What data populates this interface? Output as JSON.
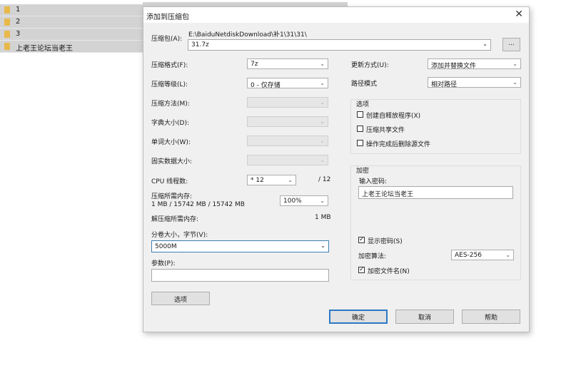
{
  "files": [
    "1",
    "2",
    "3",
    "上老王论坛当老王"
  ],
  "dialog": {
    "title": "添加到压缩包",
    "close_glyph": "✕",
    "archive_label": "压缩包(A):",
    "archive_path": "E:\\BaiduNetdiskDownload\\补1\\31\\31\\",
    "archive_name": "31.7z",
    "browse_label": "...",
    "format_label": "压缩格式(F):",
    "format_value": "7z",
    "level_label": "压缩等级(L):",
    "level_value": "0 - 仅存储",
    "method_label": "压缩方法(M):",
    "dict_label": "字典大小(D):",
    "word_label": "单词大小(W):",
    "solid_label": "固实数据大小:",
    "cpu_label": "CPU 线程数:",
    "cpu_value": "* 12",
    "cpu_max": "/ 12",
    "mem_comp_label": "压缩所需内存:",
    "mem_comp_detail": "1 MB / 15742 MB / 15742 MB",
    "mem_comp_value": "100%",
    "mem_decomp_label": "解压缩所需内存:",
    "mem_decomp_value": "1 MB",
    "split_label": "分卷大小，字节(V):",
    "split_value": "5000M",
    "params_label": "参数(P):",
    "params_value": "",
    "options_button": "选项",
    "update_label": "更新方式(U):",
    "update_value": "添加并替换文件",
    "path_label": "路径模式",
    "path_value": "相对路径",
    "options_group": "选项",
    "opt_sfx": "创建自释放程序(X)",
    "opt_shared": "压缩共享文件",
    "opt_delete": "操作完成后删除源文件",
    "encrypt_group": "加密",
    "password_label": "输入密码:",
    "password_value": "上老王论坛当老王",
    "show_password": "显示密码(S)",
    "enc_method_label": "加密算法:",
    "enc_method_value": "AES-256",
    "enc_filenames": "加密文件名(N)",
    "ok_button": "确定",
    "cancel_button": "取消",
    "help_button": "帮助",
    "check_glyph": "✓",
    "dropdown_glyph": "⌄"
  }
}
